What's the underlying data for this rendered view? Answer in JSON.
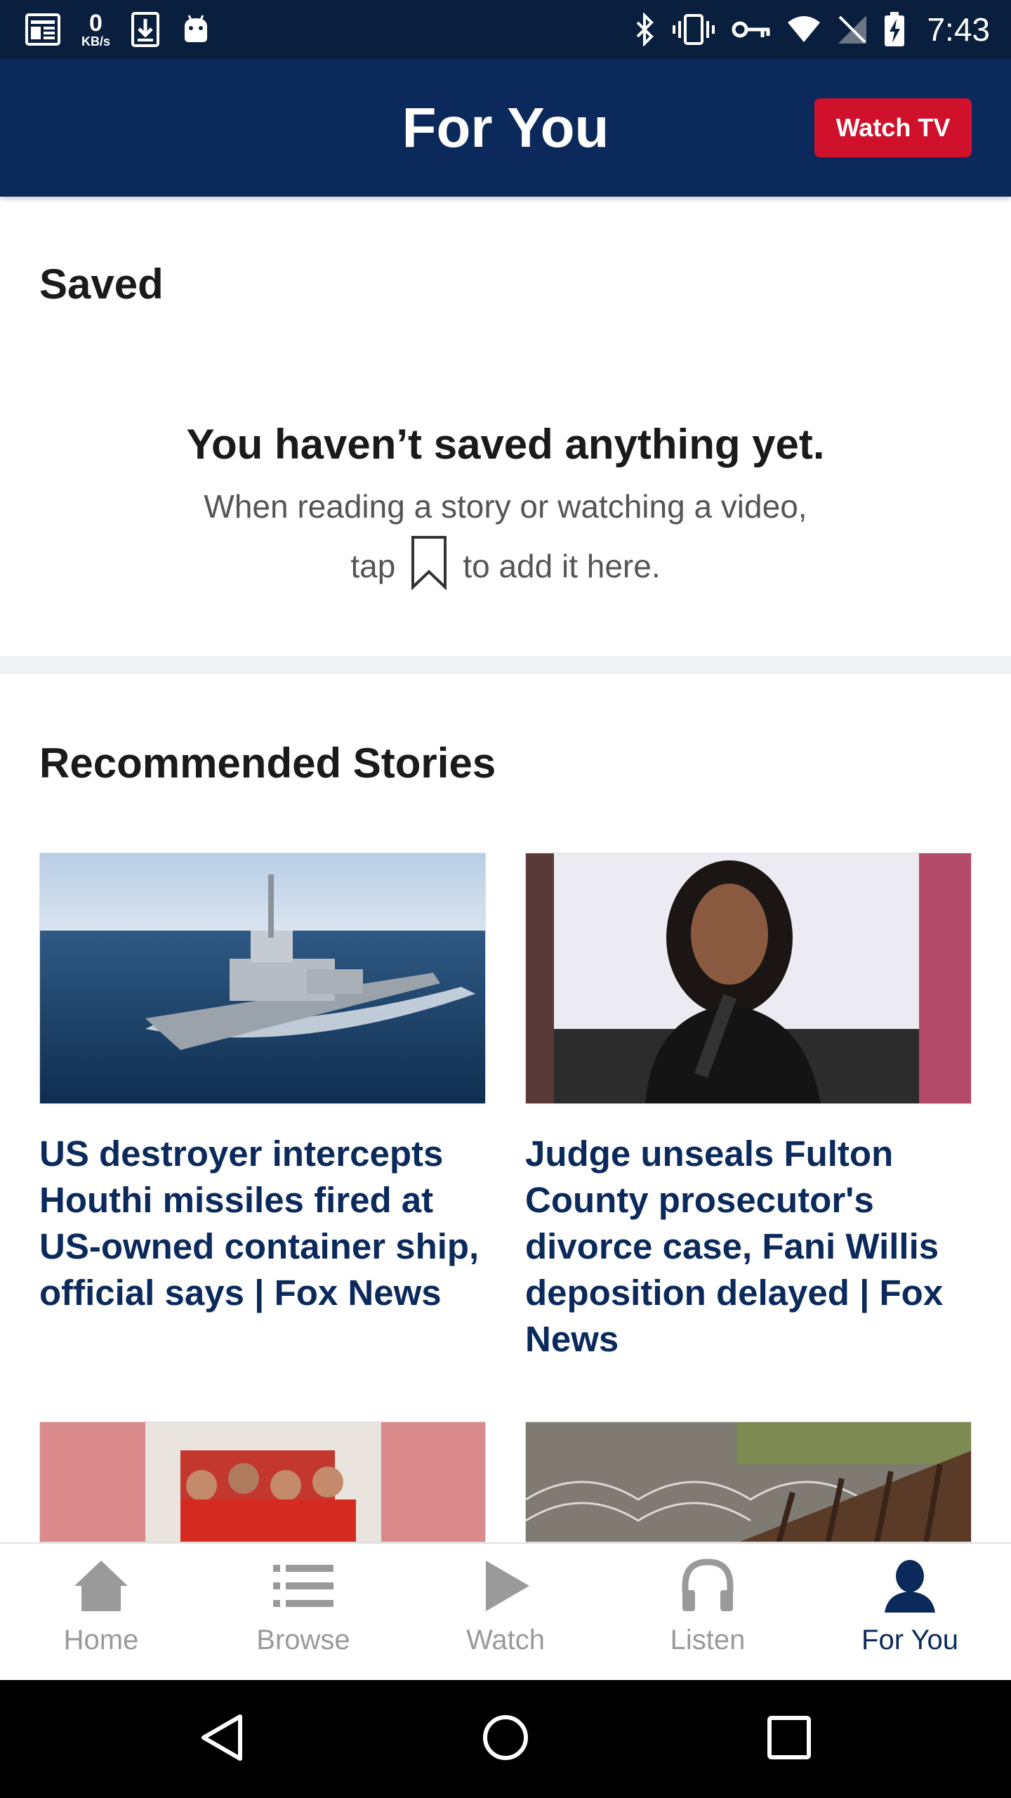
{
  "status_bar": {
    "net_speed_value": "0",
    "net_speed_unit": "KB/s",
    "time": "7:43"
  },
  "header": {
    "title": "For You",
    "watch_tv_label": "Watch TV"
  },
  "saved": {
    "heading": "Saved",
    "empty_title": "You haven’t saved anything yet.",
    "empty_line1": "When reading a story or watching a video,",
    "empty_line2_prefix": "tap",
    "empty_line2_suffix": "to add it here."
  },
  "recommended": {
    "heading": "Recommended Stories",
    "stories": [
      {
        "title": "US destroyer intercepts Houthi missiles fired at US-owned container ship, official says | Fox News"
      },
      {
        "title": "Judge unseals Fulton County prosecutor's divorce case, Fani Willis deposition delayed | Fox News"
      },
      {
        "title": ""
      },
      {
        "title": ""
      }
    ]
  },
  "bottom_nav": {
    "items": [
      {
        "label": "Home",
        "icon": "home-icon"
      },
      {
        "label": "Browse",
        "icon": "list-icon"
      },
      {
        "label": "Watch",
        "icon": "play-icon"
      },
      {
        "label": "Listen",
        "icon": "headphones-icon"
      },
      {
        "label": "For You",
        "icon": "person-icon",
        "active": true
      }
    ]
  },
  "colors": {
    "brand_navy": "#0b2a5b",
    "status_bar": "#0a1f3d",
    "watch_tv_red": "#d0112b",
    "inactive_nav": "#9a9a9a"
  }
}
